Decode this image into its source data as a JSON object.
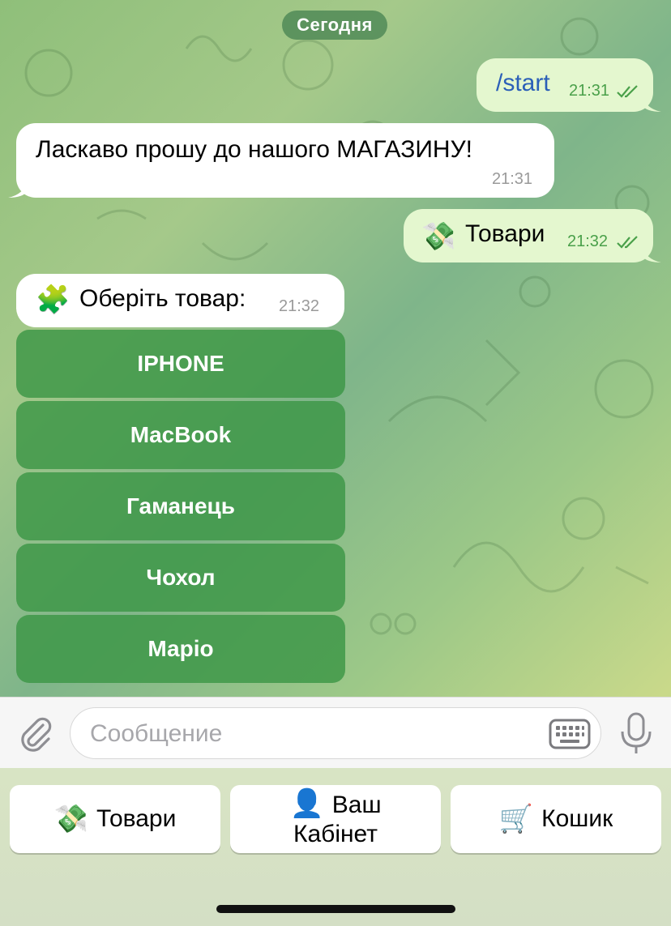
{
  "date_label": "Сегодня",
  "messages": [
    {
      "direction": "out",
      "text": "/start",
      "time": "21:31",
      "read": true
    },
    {
      "direction": "in",
      "text": "Ласкаво прошу до нашого МАГАЗИНУ!",
      "time": "21:31"
    },
    {
      "direction": "out",
      "emoji": "💸",
      "text": "Товари",
      "time": "21:32",
      "read": true
    },
    {
      "direction": "in",
      "emoji": "🧩",
      "text": "Оберіть товар:",
      "time": "21:32"
    }
  ],
  "inline_keyboard": [
    "IPHONE",
    "MacBook",
    "Гаманець",
    "Чохол",
    "Маріо"
  ],
  "composer": {
    "placeholder": "Сообщение"
  },
  "reply_keyboard": [
    {
      "icon": "💸",
      "label": "Товари"
    },
    {
      "icon": "👤",
      "label_line1": "Ваш",
      "label_line2": "Кабінет"
    },
    {
      "icon": "🛒",
      "label": "Кошик"
    }
  ],
  "colors": {
    "outgoing_bubble": "#e4f7cf",
    "incoming_bubble": "#ffffff",
    "inline_button": "#3c9646",
    "read_checks": "#4aa04a"
  }
}
